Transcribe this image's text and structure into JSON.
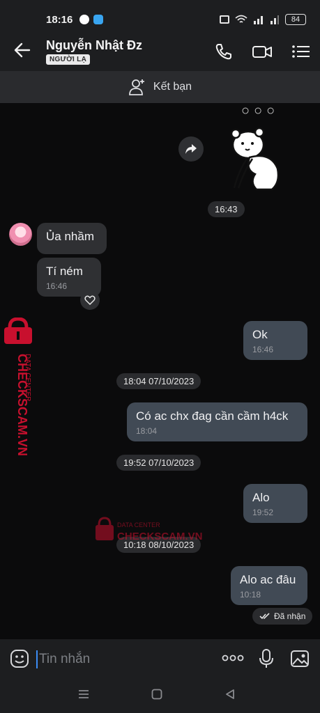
{
  "status_bar": {
    "time": "18:16",
    "battery": "84"
  },
  "header": {
    "title": "Nguyễn Nhật Đz",
    "badge": "NGƯỜI LẠ"
  },
  "friend_bar": {
    "label": "Kết bạn"
  },
  "watermark": {
    "line1": "DATA CENTER",
    "line2": "CHECKSCAM.VN"
  },
  "messages": [
    {
      "type": "time",
      "text": "16:43"
    },
    {
      "type": "in",
      "text": "Ủa nhầm"
    },
    {
      "type": "in",
      "text": "Tí ném",
      "time": "16:46"
    },
    {
      "type": "out",
      "text": "Ok",
      "time": "16:46"
    },
    {
      "type": "time",
      "text": "18:04 07/10/2023"
    },
    {
      "type": "out",
      "text": "Có ac chx đag cần cầm h4ck",
      "time": "18:04"
    },
    {
      "type": "time",
      "text": "19:52 07/10/2023"
    },
    {
      "type": "out",
      "text": "Alo",
      "time": "19:52"
    },
    {
      "type": "time",
      "text": "10:18 08/10/2023"
    },
    {
      "type": "out",
      "text": "Alo ac đâu",
      "time": "10:18"
    }
  ],
  "delivery_status": "Đã nhận",
  "composer": {
    "placeholder": "Tin nhắn"
  },
  "colors": {
    "background": "#0b0b0c",
    "bubble_in": "#2f3033",
    "bubble_out": "#414a55",
    "accent": "#3b8cf5",
    "watermark": "#c8102e"
  }
}
